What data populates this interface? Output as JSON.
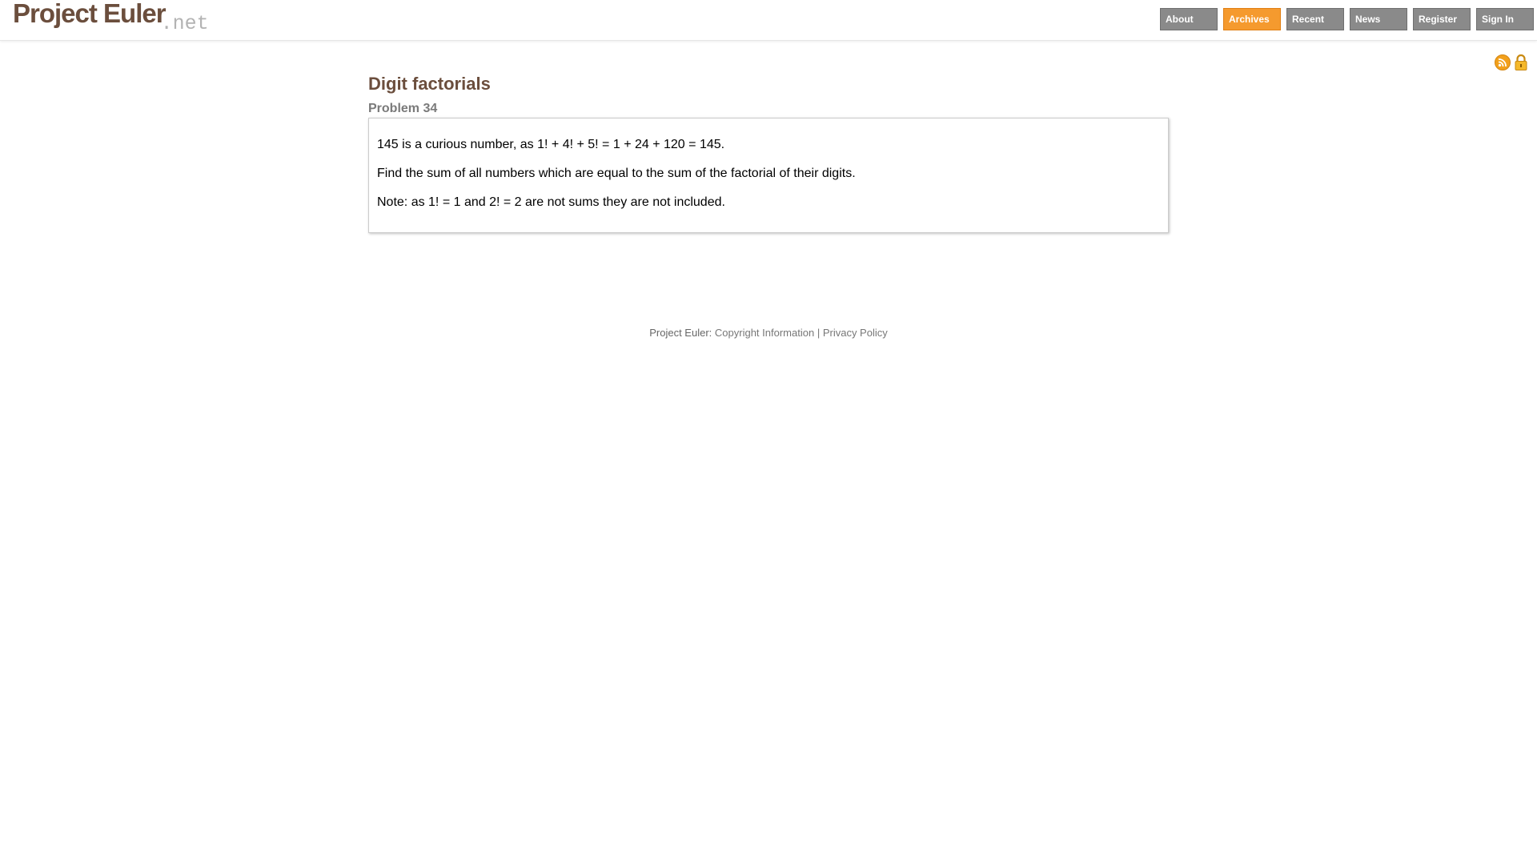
{
  "logo": {
    "main": "Project Euler",
    "suffix": ".net"
  },
  "nav": {
    "items": [
      {
        "label": "About",
        "active": false
      },
      {
        "label": "Archives",
        "active": true
      },
      {
        "label": "Recent",
        "active": false
      },
      {
        "label": "News",
        "active": false
      },
      {
        "label": "Register",
        "active": false
      },
      {
        "label": "Sign In",
        "active": false
      }
    ]
  },
  "icons": {
    "rss": "rss-icon",
    "lock": "lock-icon"
  },
  "problem": {
    "title": "Digit factorials",
    "subtitle": "Problem 34",
    "paragraphs": [
      "145 is a curious number, as 1! + 4! + 5! = 1 + 24 + 120 = 145.",
      "Find the sum of all numbers which are equal to the sum of the factorial of their digits.",
      "Note: as 1! = 1 and 2! = 2 are not sums they are not included."
    ]
  },
  "footer": {
    "prefix": "Project Euler:",
    "copyright": "Copyright Information",
    "separator": "|",
    "privacy": "Privacy Policy"
  },
  "colors": {
    "brand": "#6b4e3d",
    "nav": "#8a8a8a",
    "nav_active": "#f59a2e"
  }
}
